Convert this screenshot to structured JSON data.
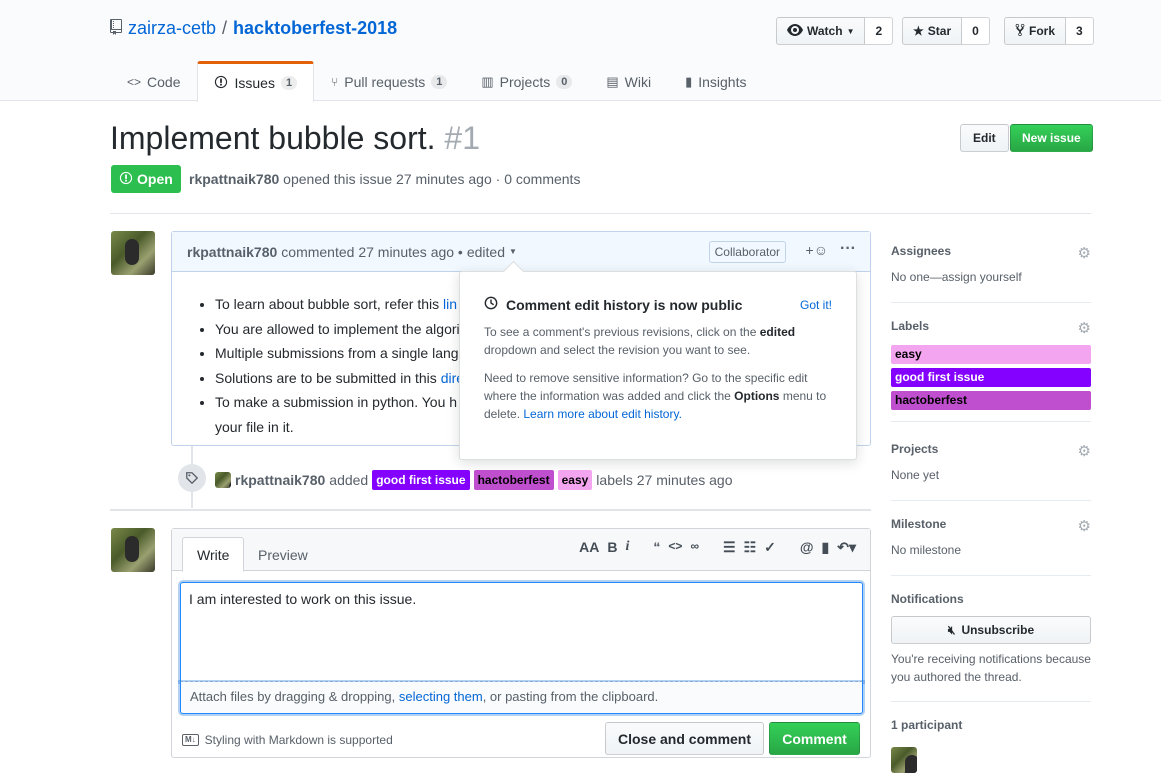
{
  "repo": {
    "owner": "zairza-cetb",
    "separator": "/",
    "name": "hacktoberfest-2018"
  },
  "actions": {
    "watch": {
      "label": "Watch",
      "count": "2"
    },
    "star": {
      "label": "Star",
      "count": "0"
    },
    "fork": {
      "label": "Fork",
      "count": "3"
    }
  },
  "tabs": [
    {
      "label": "Code",
      "count": null
    },
    {
      "label": "Issues",
      "count": "1"
    },
    {
      "label": "Pull requests",
      "count": "1"
    },
    {
      "label": "Projects",
      "count": "0"
    },
    {
      "label": "Wiki",
      "count": null
    },
    {
      "label": "Insights",
      "count": null
    }
  ],
  "issue": {
    "title": "Implement bubble sort.",
    "number": "#1",
    "state": "Open",
    "author": "rkpattnaik780",
    "meta_text": "opened this issue 27 minutes ago · 0 comments",
    "edit_label": "Edit",
    "new_issue_label": "New issue"
  },
  "comment": {
    "author": "rkpattnaik780",
    "meta": "commented 27 minutes ago •",
    "edited": "edited",
    "badge": "Collaborator",
    "items": [
      {
        "text": "To learn about bubble sort, refer this ",
        "link": "lin"
      },
      {
        "text": "You are allowed to implement the algori",
        "link": ""
      },
      {
        "text": "Multiple submissions from a single lang",
        "link": ""
      },
      {
        "text": "Solutions are to be submitted in this ",
        "link": "dire"
      },
      {
        "text": "To make a submission in python. You h",
        "link": ""
      }
    ],
    "item5_cont": "your file in it."
  },
  "popover": {
    "title": "Comment edit history is now public",
    "got_it": "Got it!",
    "p1_a": "To see a comment's previous revisions, click on the ",
    "p1_b": "edited",
    "p1_c": " dropdown and select the revision you want to see.",
    "p2_a": "Need to remove sensitive information? Go to the specific edit where the information was added and click the ",
    "p2_b": "Options",
    "p2_c": " menu to delete. ",
    "p2_link": "Learn more about edit history."
  },
  "label_event": {
    "actor": "rkpattnaik780",
    "verb": "added",
    "labels": [
      "good first issue",
      "hactoberfest",
      "easy"
    ],
    "suffix": "labels 27 minutes ago"
  },
  "composer": {
    "write_tab": "Write",
    "preview_tab": "Preview",
    "text": "I am interested to work on this issue.",
    "drop_a": "Attach files by dragging & dropping, ",
    "drop_link": "selecting them",
    "drop_b": ", or pasting from the clipboard.",
    "markdown_note": "Styling with Markdown is supported",
    "close_label": "Close and comment",
    "comment_label": "Comment"
  },
  "sidebar": {
    "assignees": {
      "heading": "Assignees",
      "value": "No one—assign yourself"
    },
    "labels": {
      "heading": "Labels",
      "items": [
        "easy",
        "good first issue",
        "hactoberfest"
      ]
    },
    "projects": {
      "heading": "Projects",
      "value": "None yet"
    },
    "milestone": {
      "heading": "Milestone",
      "value": "No milestone"
    },
    "notifications": {
      "heading": "Notifications",
      "button": "Unsubscribe",
      "note": "You're receiving notifications because you authored the thread."
    },
    "participants": {
      "heading": "1 participant"
    }
  },
  "colors": {
    "label_easy": "#f4a5f0",
    "label_good_first_issue": "#8400ff",
    "label_hactoberfest": "#c04fd0",
    "open_green": "#2cbe4e",
    "link_blue": "#0366d6"
  }
}
